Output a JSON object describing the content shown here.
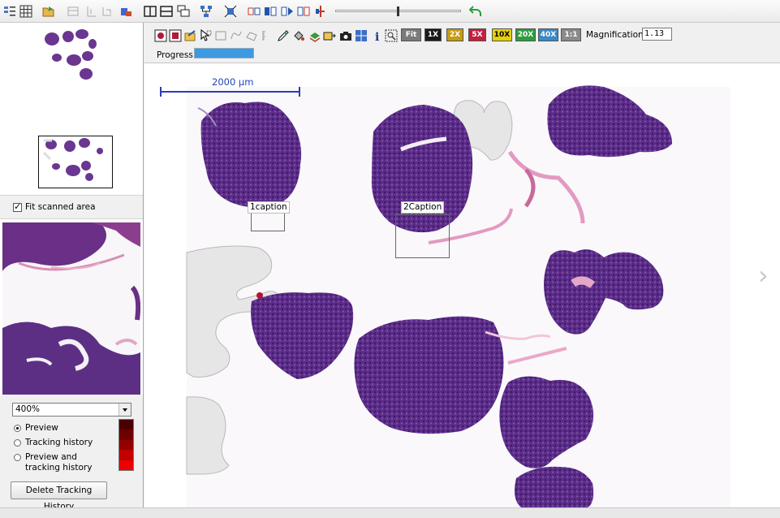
{
  "viewer": {
    "fit_button": "Fit",
    "zoom_buttons": [
      {
        "label": "1X",
        "color": "#1a1a1a"
      },
      {
        "label": "2X",
        "color": "#c79b10"
      },
      {
        "label": "5X",
        "color": "#c2203f"
      },
      {
        "label": "10X",
        "color": "#e6d00c"
      },
      {
        "label": "20X",
        "color": "#2e9c3e"
      },
      {
        "label": "40X",
        "color": "#3a88c8"
      },
      {
        "label": "1:1",
        "color": "#8a8a8a"
      }
    ],
    "magnification_label": "Magnification:",
    "magnification_value": "1.13",
    "progress_label": "Progress:",
    "progress_fraction": 1.0,
    "progress_color": "#3b9ae1",
    "scale_bar_label": "2000 µm",
    "scale_bar_color": "#2a3fb5",
    "captions": [
      "1caption",
      "2Caption"
    ],
    "tissue_color": "#5b2d88",
    "annotation_region_color": "#e6e6e6"
  },
  "left_panel": {
    "fit_scanned_area_label": "Fit scanned area",
    "fit_scanned_area_checked": true,
    "zoom_select_value": "400%",
    "radio_options": [
      {
        "label": "Preview",
        "selected": true
      },
      {
        "label": "Tracking history",
        "selected": false
      },
      {
        "label": "Preview and tracking history",
        "selected": false
      }
    ],
    "radio_option_3_line1": "Preview and",
    "radio_option_3_line2": "tracking history",
    "heat_colors": [
      "#4a0000",
      "#6e0000",
      "#940000",
      "#c20000",
      "#ee0000"
    ],
    "delete_button_label": "Delete Tracking History"
  },
  "icons": {
    "top_toolbar": [
      "grid-small-icon",
      "grid-large-icon",
      "open-folder-icon",
      "disabled-tool-1-icon",
      "disabled-tool-2-icon",
      "disabled-tool-3-icon",
      "slide-label-icon",
      "single-pane-icon",
      "two-pane-icon",
      "cascade-icon",
      "network-icon",
      "fullscreen-icon",
      "sync-1-icon",
      "sync-2-icon",
      "sync-3-icon",
      "sync-4-icon",
      "sync-5-icon",
      "undo-arrow-icon"
    ],
    "viewer_toolbar": [
      "record-icon",
      "stop-icon",
      "export-icon",
      "select-cursor-icon",
      "rect-icon",
      "freehand-icon",
      "polygon-icon",
      "ruler-icon",
      "pen-icon",
      "paint-icon",
      "layers-icon",
      "export-image-icon",
      "camera-icon",
      "snapshot-icon",
      "info-icon",
      "zoom-region-icon"
    ]
  }
}
